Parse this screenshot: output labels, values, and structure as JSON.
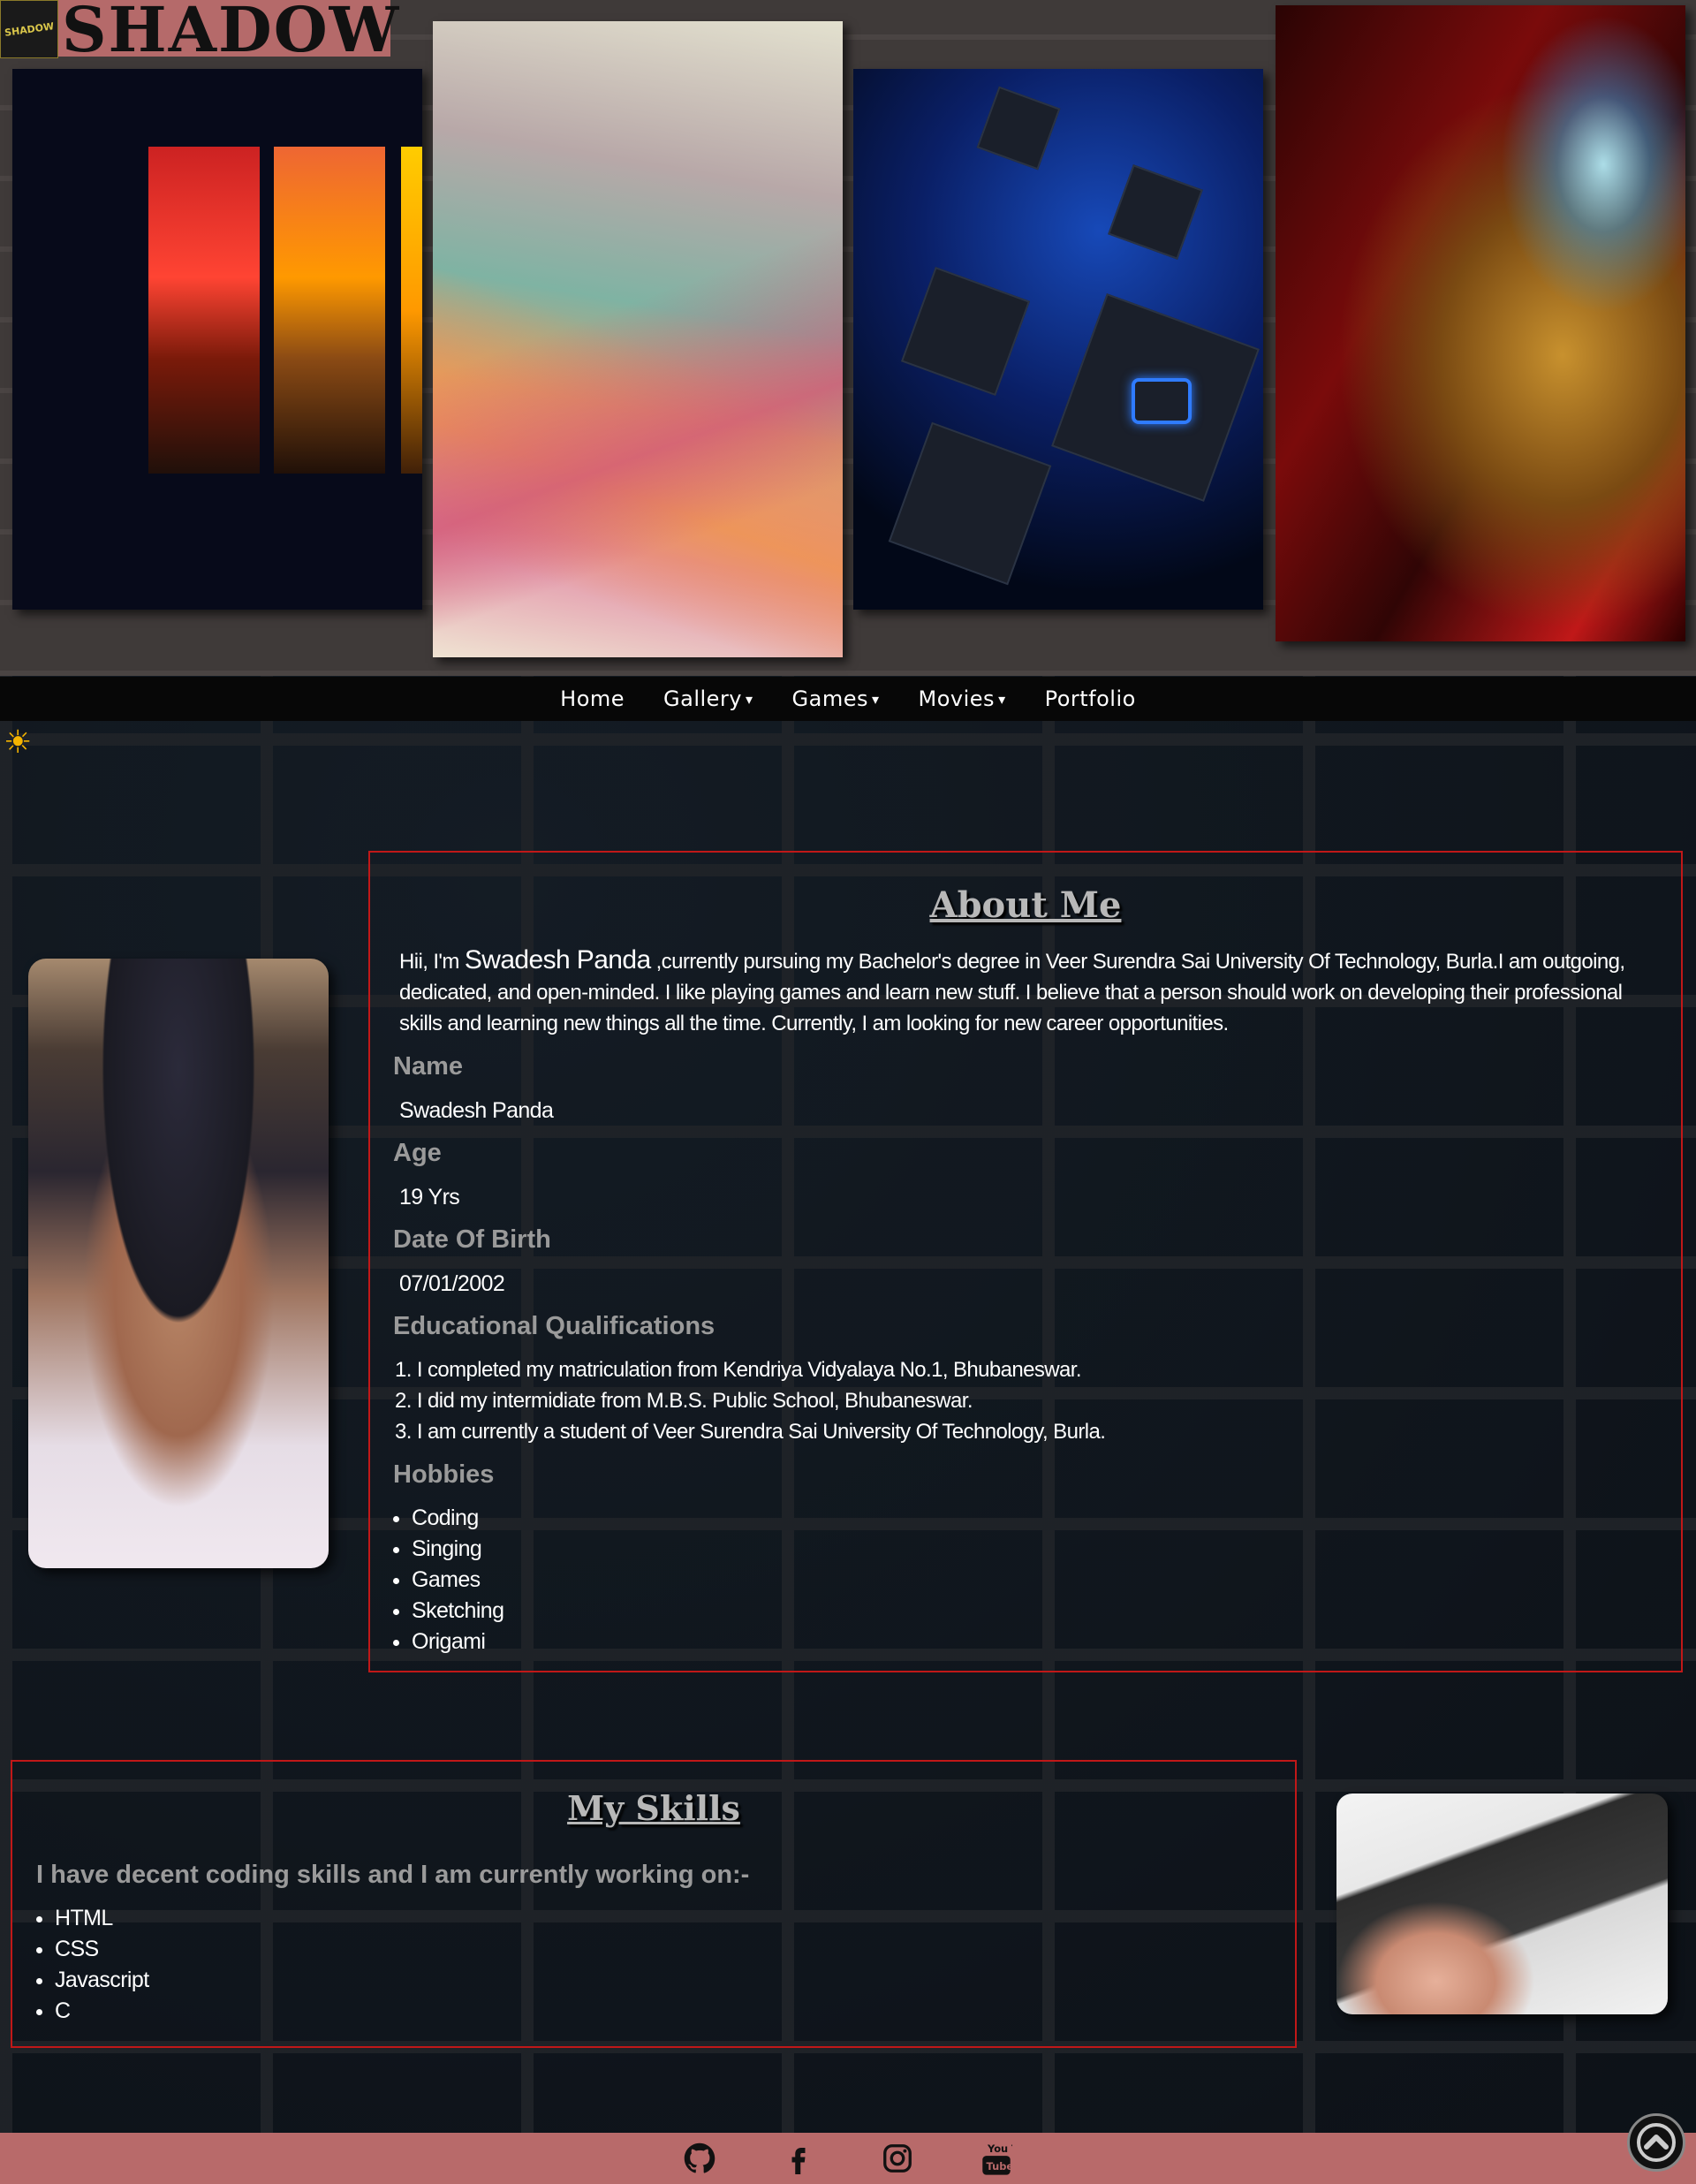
{
  "header": {
    "logo_text": "SHADOW",
    "brand": "SHADOW",
    "hero_images": [
      "sunset-strips-image",
      "origami-cranes-image",
      "playstation-cubes-image",
      "iron-man-image"
    ]
  },
  "nav": {
    "items": [
      {
        "label": "Home",
        "dropdown": false
      },
      {
        "label": "Gallery",
        "dropdown": true
      },
      {
        "label": "Games",
        "dropdown": true
      },
      {
        "label": "Movies",
        "dropdown": true
      },
      {
        "label": "Portfolio",
        "dropdown": false
      }
    ],
    "caret": "▾"
  },
  "theme_toggle": {
    "icon": "sun-icon",
    "glyph": "☀"
  },
  "about": {
    "title": "About Me",
    "intro_before": "Hii, I'm ",
    "intro_name": "Swadesh Panda",
    "intro_after": " ,currently pursuing my Bachelor's degree in Veer Surendra Sai University Of Technology, Burla.I am outgoing, dedicated, and open-minded. I like playing games and learn new stuff. I believe that a person should work on developing their professional skills and learning new things all the time. Currently, I am looking for new career opportunities.",
    "name_label": "Name",
    "name_value": "Swadesh Panda",
    "age_label": "Age",
    "age_value": "19 Yrs",
    "dob_label": "Date Of Birth",
    "dob_value": "07/01/2002",
    "edu_label": "Educational Qualifications",
    "edu_items": [
      "1. I completed my matriculation from Kendriya Vidyalaya No.1, Bhubaneswar.",
      "2. I did my intermidiate from M.B.S. Public School, Bhubaneswar.",
      "3. I am currently a student of Veer Surendra Sai University Of Technology, Burla."
    ],
    "hobbies_label": "Hobbies",
    "hobbies": [
      "Coding",
      "Singing",
      "Games",
      "Sketching",
      "Origami"
    ]
  },
  "skills": {
    "title": "My Skills",
    "intro": "I have decent coding skills and I am currently working on:-",
    "items": [
      "HTML",
      "CSS",
      "Javascript",
      "C"
    ]
  },
  "footer": {
    "social": [
      "github-icon",
      "facebook-icon",
      "instagram-icon",
      "youtube-icon"
    ],
    "youtube_text": "You Tube",
    "back_to_top": "chevron-up-icon"
  },
  "colors": {
    "accent_border": "#c01818",
    "footer_bg": "#b86a6a",
    "nav_bg": "#070707",
    "heading_gray": "#9a9a9a"
  }
}
